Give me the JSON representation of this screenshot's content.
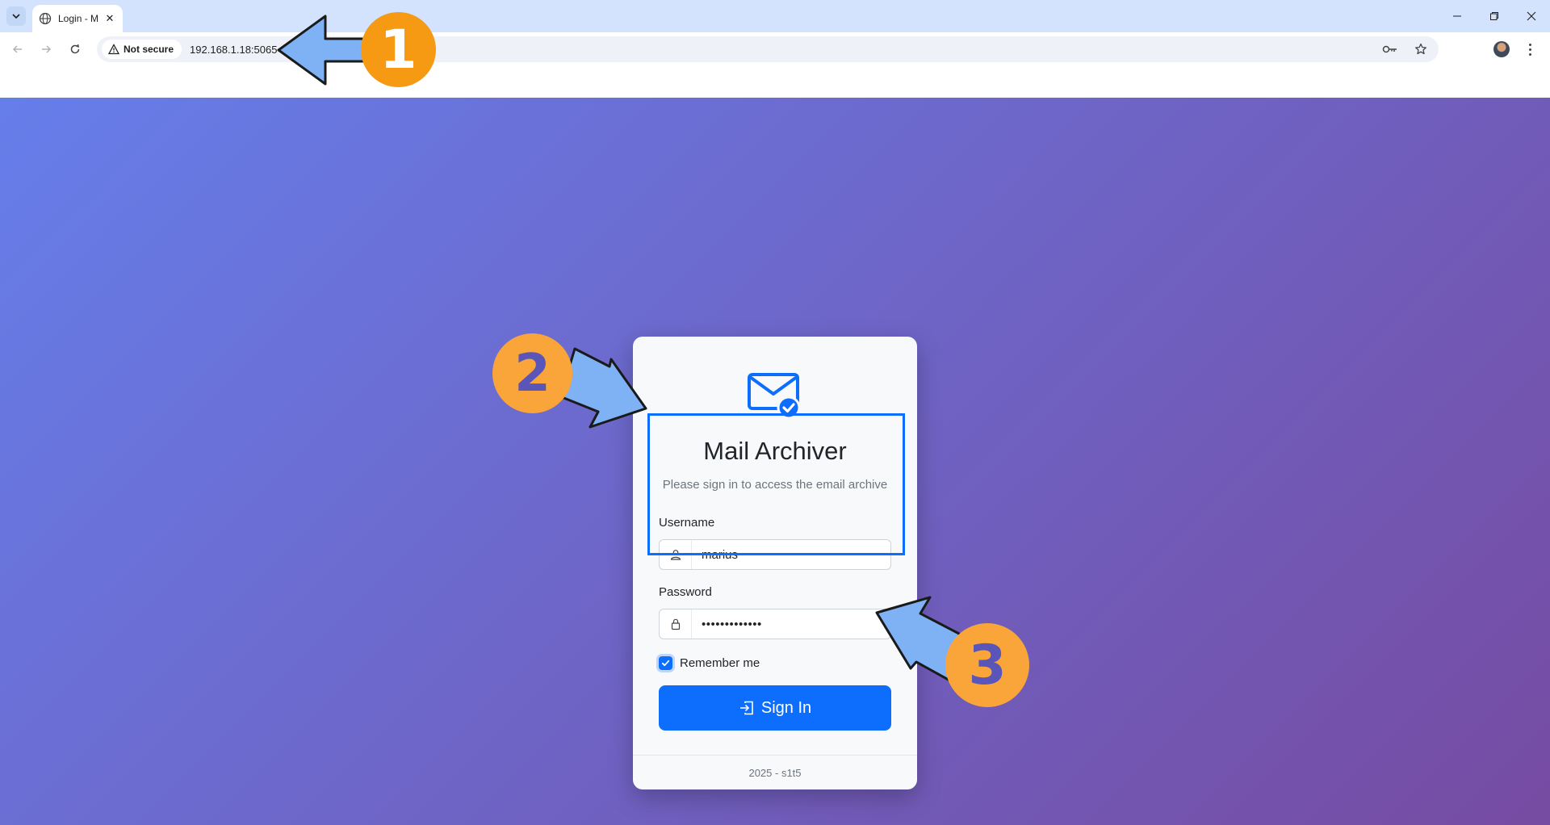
{
  "browser": {
    "tab_title": "Login - M",
    "security_chip": "Not secure",
    "url": "192.168.1.18:5065"
  },
  "login": {
    "app_title": "Mail Archiver",
    "subtitle": "Please sign in to access the email archive",
    "username_label": "Username",
    "username_value": "marius",
    "password_label": "Password",
    "password_value_masked": "•••••••••••••",
    "remember_label": "Remember me",
    "remember_checked": true,
    "signin_label": "Sign In",
    "footer": "2025 - s1t5"
  },
  "annotations": {
    "step1": "1",
    "step2": "2",
    "step3": "3"
  },
  "colors": {
    "gradient_start": "#667eea",
    "gradient_end": "#764ba2",
    "primary": "#0d6efd",
    "badge_orange": "#f9a53a",
    "arrow_blue": "#7fb2f5"
  }
}
